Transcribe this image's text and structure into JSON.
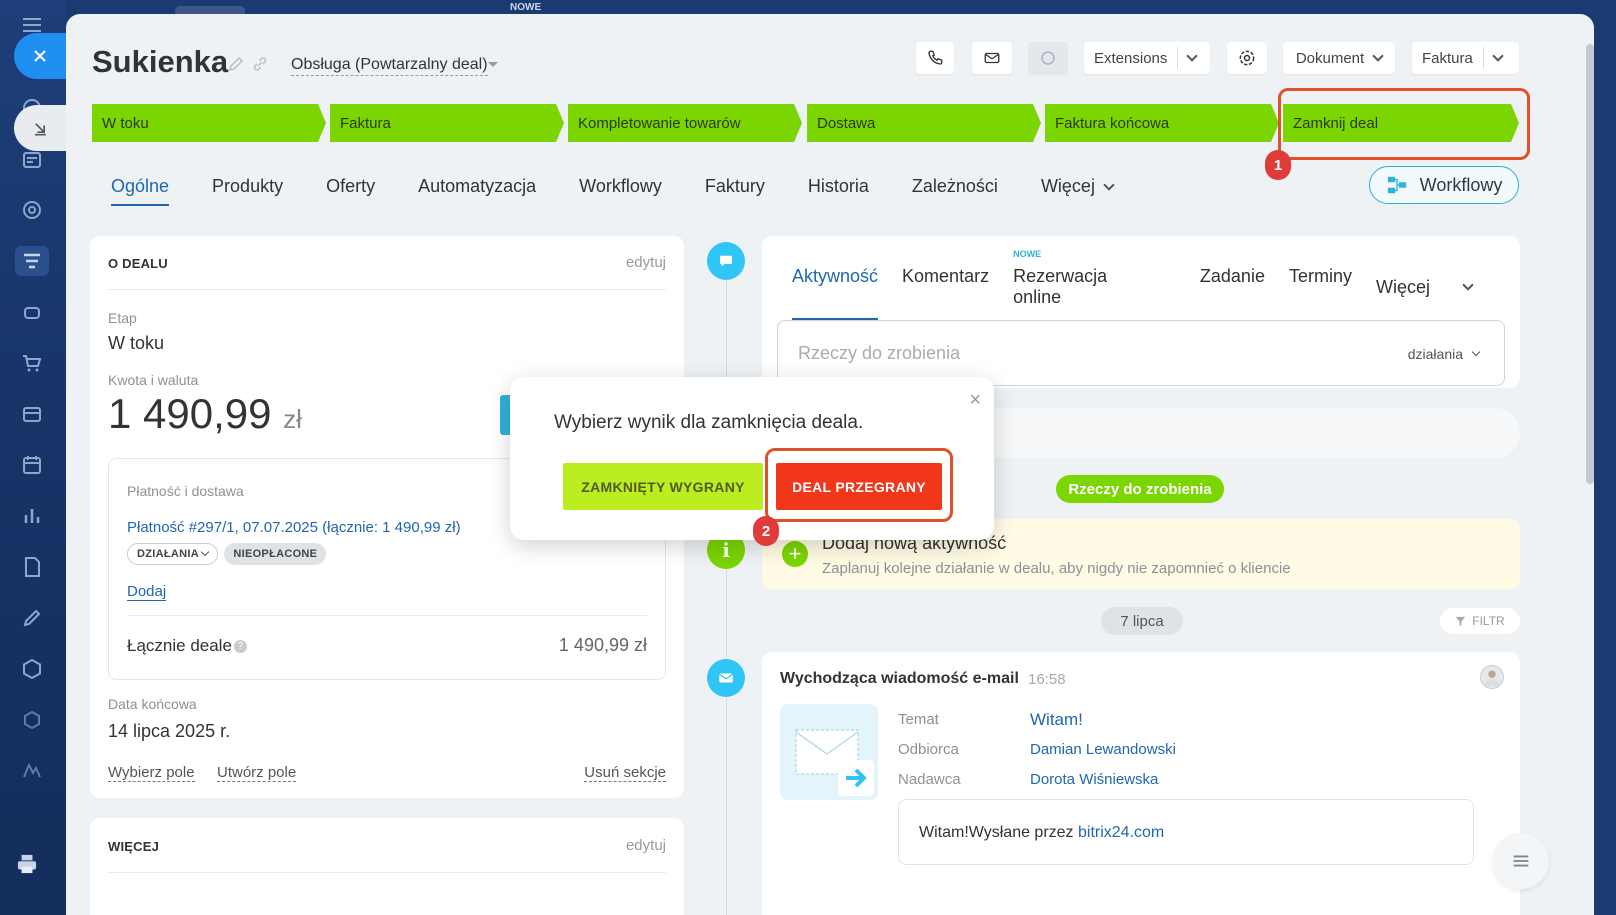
{
  "top_strip": {
    "badge": "NOWE"
  },
  "header": {
    "title": "Sukienka",
    "category": "Obsługa (Powtarzalny deal)",
    "extensions_label": "Extensions",
    "dokument_label": "Dokument",
    "faktura_label": "Faktura"
  },
  "stages": [
    {
      "label": "W toku"
    },
    {
      "label": "Faktura"
    },
    {
      "label": "Kompletowanie towarów"
    },
    {
      "label": "Dostawa"
    },
    {
      "label": "Faktura końcowa"
    },
    {
      "label": "Zamknij deal"
    }
  ],
  "markers": {
    "first": "1",
    "second": "2"
  },
  "tabs": [
    "Ogólne",
    "Produkty",
    "Oferty",
    "Automatyzacja",
    "Workflowy",
    "Faktury",
    "Historia",
    "Zależności",
    "Więcej"
  ],
  "workflow_button": "Workflowy",
  "deal_card": {
    "heading": "O DEALU",
    "edit": "edytuj",
    "stage_label": "Etap",
    "stage_value": "W toku",
    "amount_label": "Kwota i waluta",
    "amount": "1 490,99",
    "currency": "zł",
    "payment": {
      "label": "Płatność i dostawa",
      "link": "Płatność #297/1, 07.07.2025 (łącznie: 1 490,99 zł)",
      "actions_pill": "DZIAŁANIA",
      "status_pill": "NIEOPŁACONE",
      "add": "Dodaj",
      "total_label": "Łącznie deale",
      "total_value": "1 490,99 zł"
    },
    "end_date_label": "Data końcowa",
    "end_date_value": "14 lipca 2025 r.",
    "footer": {
      "select_field": "Wybierz pole",
      "create_field": "Utwórz pole",
      "delete_section": "Usuń sekcje"
    }
  },
  "more_card": {
    "heading": "WIĘCEJ",
    "edit": "edytuj"
  },
  "editor": {
    "tabs": [
      "Aktywność",
      "Komentarz",
      "Rezerwacja online",
      "Zadanie",
      "Terminy",
      "Więcej"
    ],
    "new_badge": "NOWE",
    "placeholder": "Rzeczy do zrobienia",
    "actions": "działania"
  },
  "timeline": {
    "todo_pill": "Rzeczy do zrobienia",
    "add_activity_title": "Dodaj nową aktywność",
    "add_activity_sub": "Zaplanuj kolejne działanie w dealu, aby nigdy nie zapomnieć o kliencie",
    "date_pill": "7 lipca",
    "filter": "FILTR",
    "email": {
      "title": "Wychodząca wiadomość e-mail",
      "time": "16:58",
      "subject_label": "Temat",
      "subject": "Witam!",
      "recipient_label": "Odbiorca",
      "recipient": "Damian Lewandowski",
      "sender_label": "Nadawca",
      "sender": "Dorota Wiśniewska",
      "body_prefix": "Witam!Wysłane przez ",
      "body_link": "bitrix24.com"
    }
  },
  "popup": {
    "title": "Wybierz wynik dla zamknięcia deala.",
    "won_button": "ZAMKNIĘTY WYGRANY",
    "lost_button": "DEAL PRZEGRANY",
    "close": "×"
  },
  "colors": {
    "stage_green": "#7bd500",
    "won": "#bbed21",
    "lost": "#f1361a",
    "highlight": "#e0502a",
    "link": "#2067b0"
  }
}
